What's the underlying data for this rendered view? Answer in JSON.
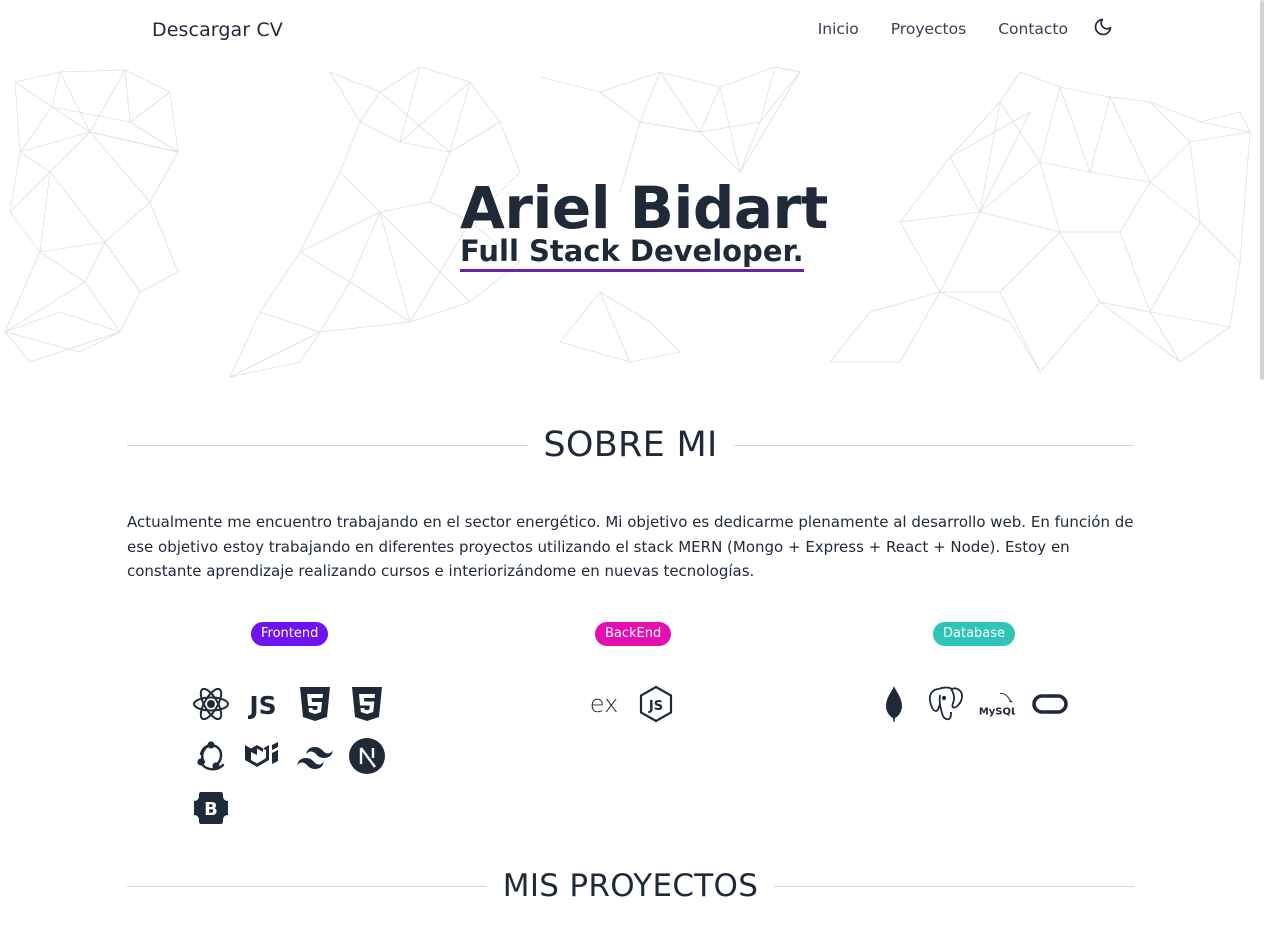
{
  "nav": {
    "brand": "Descargar CV",
    "links": [
      "Inicio",
      "Proyectos",
      "Contacto"
    ],
    "theme_icon": "moon-icon"
  },
  "hero": {
    "name": "Ariel Bidart",
    "role": "Full Stack Developer."
  },
  "about": {
    "title": "SOBRE MI",
    "text": "Actualmente me encuentro trabajando en el sector energético. Mi objetivo es dedicarme plenamente al desarrollo web. En función de ese objetivo estoy trabajando en diferentes proyectos utilizando el stack MERN (Mongo + Express + React + Node). Estoy en constante aprendizaje realizando cursos e interiorizándome en nuevas tecnologías."
  },
  "skills": {
    "frontend": {
      "label": "Frontend",
      "color": "#6d13f0",
      "icons": [
        "react-icon",
        "javascript-icon",
        "html5-icon",
        "css3-icon",
        "redux-icon",
        "material-ui-icon",
        "tailwind-icon",
        "nextjs-icon",
        "bootstrap-icon"
      ]
    },
    "backend": {
      "label": "BackEnd",
      "color": "#e40fb0",
      "icons": [
        "express-icon",
        "nodejs-icon"
      ]
    },
    "database": {
      "label": "Database",
      "color": "#2ec4b6",
      "icons": [
        "mongodb-icon",
        "postgresql-icon",
        "mysql-icon",
        "oracle-icon"
      ],
      "mysql_text": "MySQL"
    }
  },
  "projects": {
    "title": "MIS PROYECTOS"
  }
}
